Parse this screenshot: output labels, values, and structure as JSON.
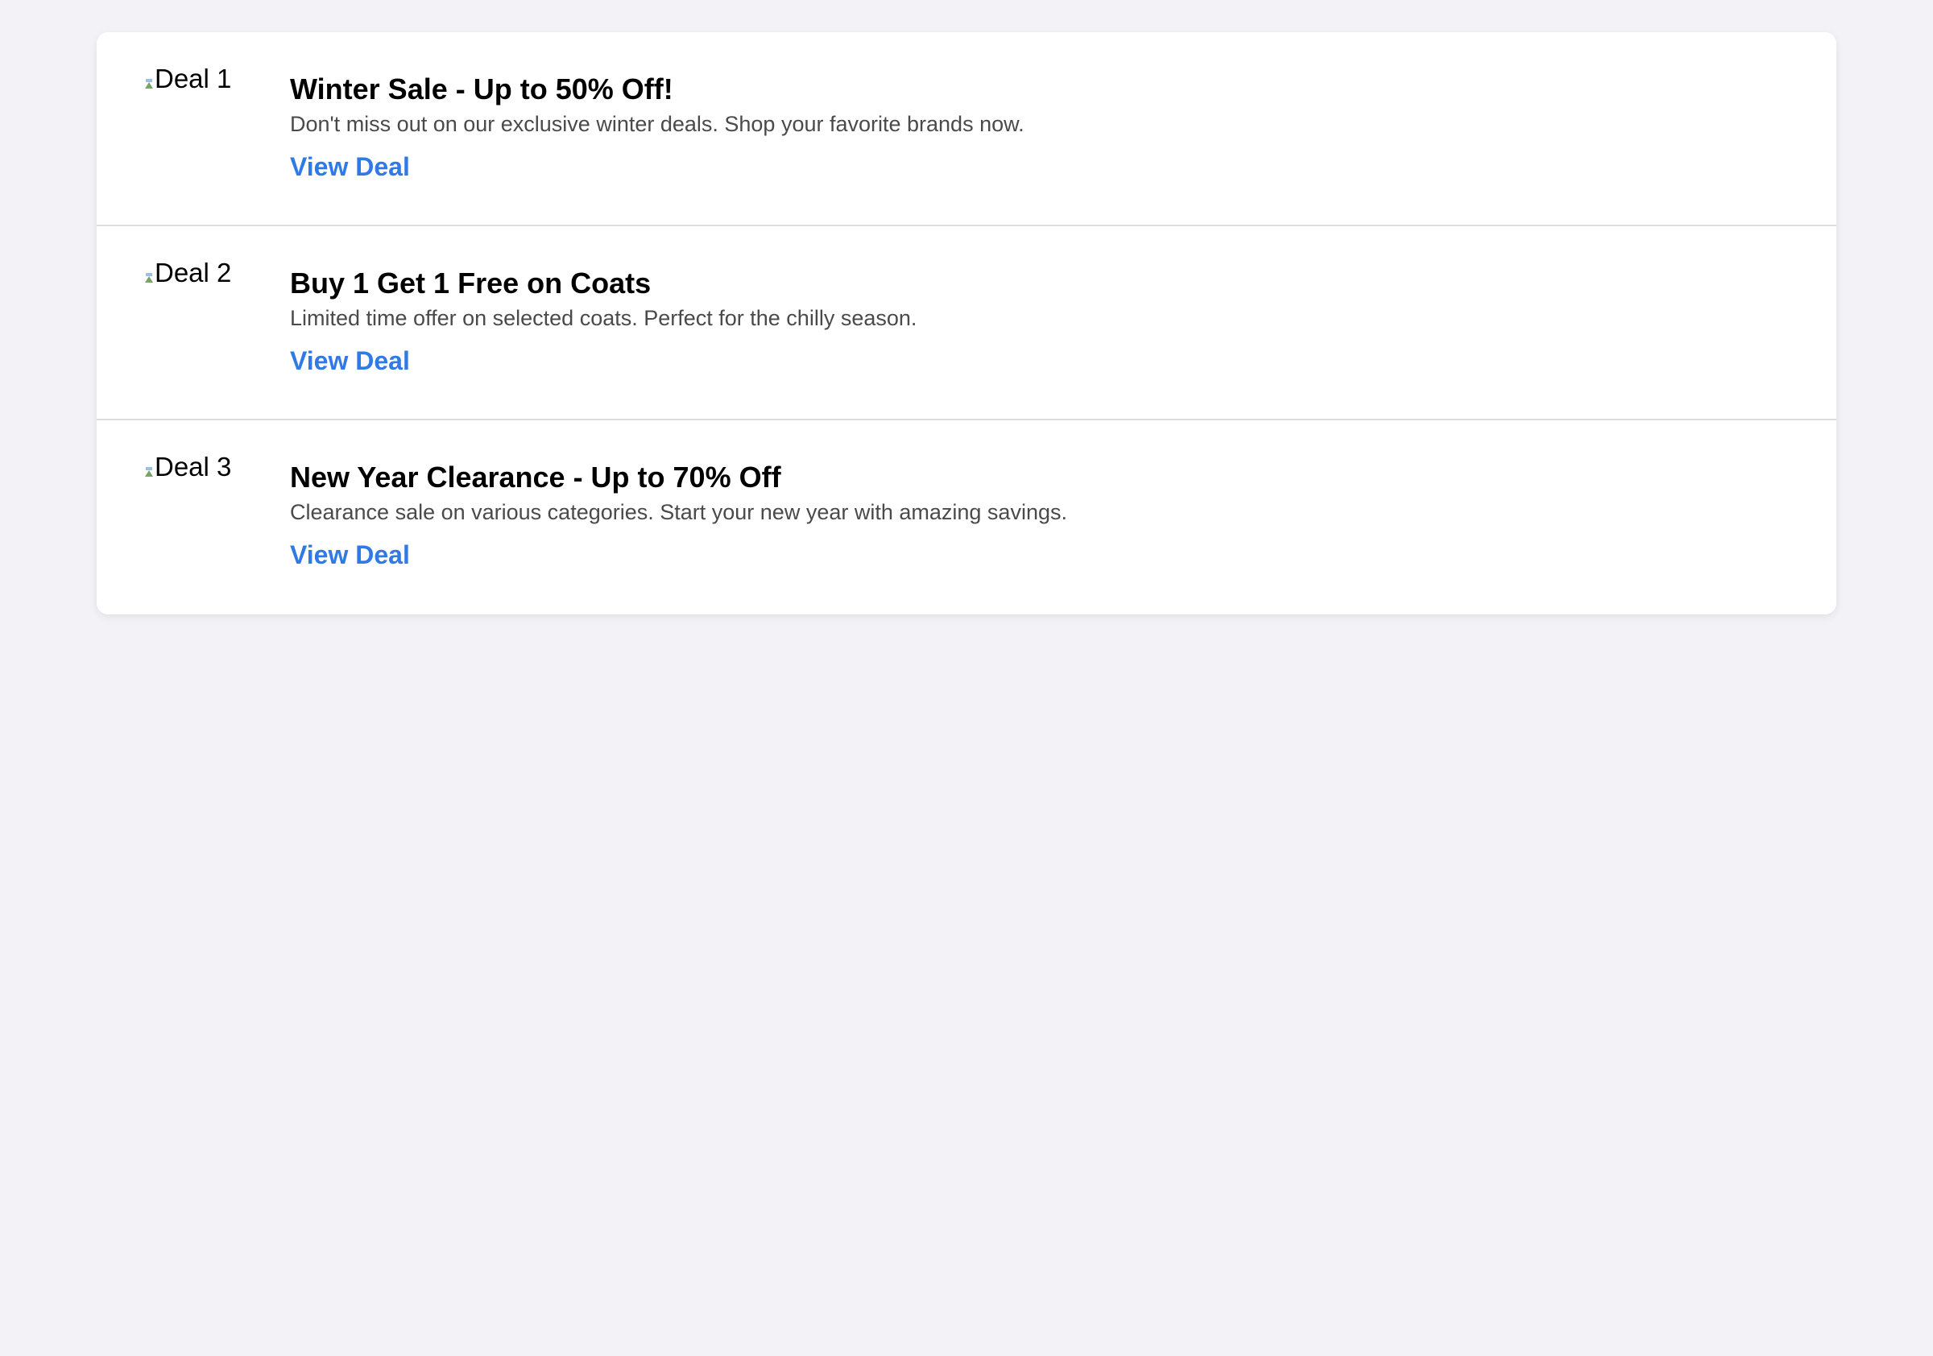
{
  "deals": [
    {
      "image_alt": "Deal 1",
      "title": "Winter Sale - Up to 50% Off!",
      "description": "Don't miss out on our exclusive winter deals. Shop your favorite brands now.",
      "link_label": "View Deal"
    },
    {
      "image_alt": "Deal 2",
      "title": "Buy 1 Get 1 Free on Coats",
      "description": "Limited time offer on selected coats. Perfect for the chilly season.",
      "link_label": "View Deal"
    },
    {
      "image_alt": "Deal 3",
      "title": "New Year Clearance - Up to 70% Off",
      "description": "Clearance sale on various categories. Start your new year with amazing savings.",
      "link_label": "View Deal"
    }
  ],
  "colors": {
    "page_background": "#f3f3f7",
    "card_background": "#ffffff",
    "link": "#2f7ae5",
    "description_text": "#4a4a4a",
    "divider": "#dcdcdc"
  }
}
